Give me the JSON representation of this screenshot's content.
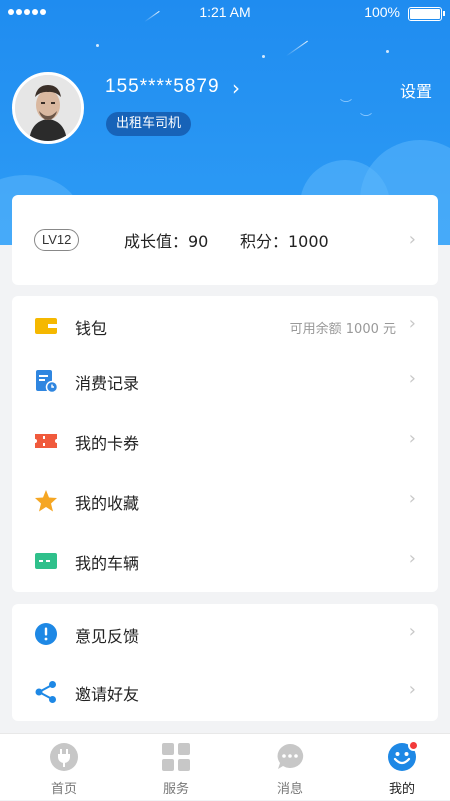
{
  "status_bar": {
    "time": "1:21 AM",
    "battery": "100%",
    "battery_level": 1.0
  },
  "profile": {
    "phone": "155****5879",
    "role": "出租车司机",
    "settings_label": "设置"
  },
  "level_card": {
    "level": "LV12",
    "growth": "成长值：90",
    "points": "积分：1000"
  },
  "menu_group_1": [
    {
      "label": "钱包",
      "extra": "可用余额 1000 元",
      "icon": "wallet-icon"
    },
    {
      "label": "消费记录",
      "icon": "receipt-icon"
    },
    {
      "label": "我的卡券",
      "icon": "coupon-icon"
    },
    {
      "label": "我的收藏",
      "icon": "star-icon"
    },
    {
      "label": "我的车辆",
      "icon": "car-card-icon"
    }
  ],
  "menu_group_2": [
    {
      "label": "意见反馈",
      "icon": "feedback-icon"
    },
    {
      "label": "邀请好友",
      "icon": "share-icon"
    }
  ],
  "tabbar": [
    {
      "label": "首页",
      "icon": "home-plug-icon"
    },
    {
      "label": "服务",
      "icon": "grid-icon"
    },
    {
      "label": "消息",
      "icon": "chat-icon"
    },
    {
      "label": "我的",
      "icon": "profile-face-icon",
      "active": true
    }
  ],
  "colors": {
    "header_blue": "#1f8cf0",
    "wallet_yellow": "#f5b800",
    "receipt_blue": "#2f86e0",
    "coupon_red": "#f05a3c",
    "star_orange": "#f5a623",
    "car_green": "#2fc08b",
    "feedback_blue": "#1e88e5",
    "share_blue": "#1e88e5",
    "badge_red": "#f23a3a"
  }
}
